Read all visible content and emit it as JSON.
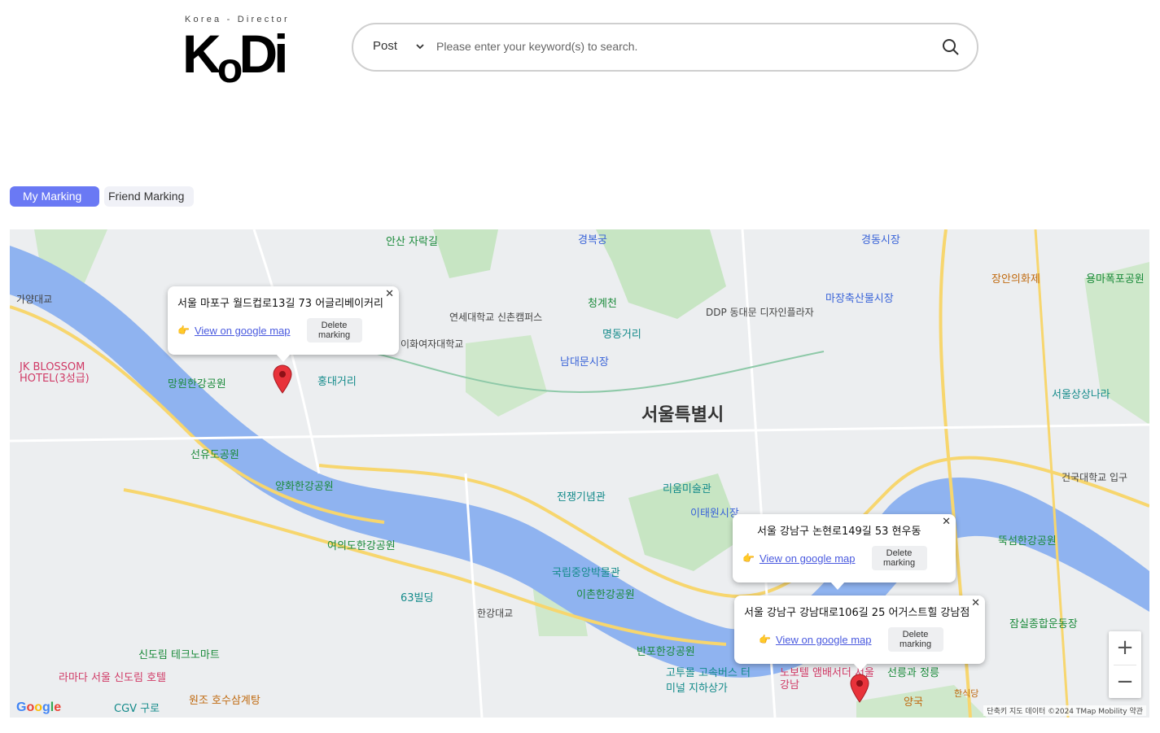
{
  "brand": {
    "tagline": "Korea - Director",
    "name_parts": [
      "K",
      "o",
      "Di"
    ]
  },
  "search": {
    "type_value": "Post",
    "placeholder": "Please enter your keyword(s) to search."
  },
  "tabs": [
    {
      "label": "My Marking",
      "active": true
    },
    {
      "label": "Friend Marking",
      "active": false
    }
  ],
  "map": {
    "labels": {
      "city": "서울특별시",
      "mangwon": "망원한강공원",
      "seonyudo": "선유도공원",
      "yanghwa": "양화한강공원",
      "yeouido": "여의도한강공원",
      "building63": "63빌딩",
      "hongdae": "홍대거리",
      "yonsei": "연세대학교 신촌캠퍼스",
      "ewha": "이화여자대학교",
      "namdaemun": "남대문시장",
      "myeongdong": "명동거리",
      "cheonggye": "청계천",
      "gyeongbok": "경복궁",
      "ddp": "DDP 동대문 디자인플라자",
      "majang": "마장축산물시장",
      "gyeongdong": "경동시장",
      "jangan": "장안의화제",
      "yongma": "용마폭포공원",
      "seoulsangsang": "서울상상나라",
      "ttukseom": "뚝섬한강공원",
      "konkuk": "건국대학교 입구",
      "warmemorial": "전쟁기념관",
      "leeum": "리움미술관",
      "itaewon": "이태원시장",
      "museum": "국립중앙박물관",
      "ichon": "이촌한강공원",
      "hangangbridge": "한강대교",
      "banpo": "반포한강공원",
      "gosok": "고투몰 고속버스 터미널 지하상가",
      "jamsil": "잠실종합운동장",
      "seolleung": "선릉과 정릉",
      "anshan": "안산 자락길",
      "gayang": "가양대교",
      "jkblossom": "JK BLOSSOM HOTEL(3성급)",
      "sindorim": "신도림 테크노마트",
      "ramada": "라마다 서울 신도림 호텔",
      "cgv": "CGV 구로",
      "wonjo": "원조 호수삼계탕",
      "novotel": "노보텔 앰배서더 서울 강남",
      "yangkook": "양국",
      "hansikdang": "한식당"
    },
    "popups": [
      {
        "address": "서울 마포구 월드컵로13길 73 어글리베이커리",
        "link": "View on google map",
        "delete": "Delete marking"
      },
      {
        "address": "서울 강남구 논현로149길 53 현우동",
        "link": "View on google map",
        "delete": "Delete marking"
      },
      {
        "address": "서울 강남구 강남대로106길 25 어거스트힐 강남점",
        "link": "View on google map",
        "delete": "Delete marking"
      }
    ],
    "zoom": {
      "in": "+",
      "out": "−"
    },
    "google": "Google",
    "attribution": "단축키   지도 데이터 ©2024 TMap Mobility   약관"
  },
  "colors": {
    "accent": "#6a79f4",
    "river": "#8fb3f0",
    "park": "#c4e3c0",
    "pin": "#e8323a"
  },
  "icons": {
    "search": "search-icon",
    "chevron": "chevron-down-icon",
    "close": "close-icon",
    "hand": "pointing-hand-icon",
    "pin": "map-pin-icon"
  }
}
